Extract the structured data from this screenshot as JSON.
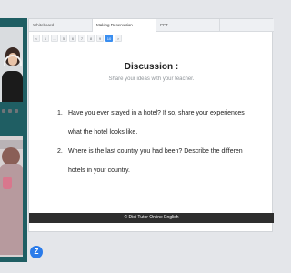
{
  "tabs": [
    {
      "label": "Whiteboard",
      "active": false
    },
    {
      "label": "Making Reservation",
      "active": true
    },
    {
      "label": "PPT",
      "active": false
    }
  ],
  "pager": {
    "buttons": [
      "<",
      "1",
      "...",
      "5",
      "6",
      "7",
      "8",
      "9",
      "10",
      ">"
    ],
    "current": "10"
  },
  "slide": {
    "title": "Discussion :",
    "subtitle": "Share your ideas with your teacher.",
    "questions": [
      {
        "num": "1.",
        "line1": "Have you ever stayed in a hotel? If so, share your experiences",
        "line2": "what the hotel looks like."
      },
      {
        "num": "2.",
        "line1": "Where is the last country you had been? Describe the differen",
        "line2": "hotels in your country."
      }
    ],
    "footer": "© Didi Tutor Online English"
  },
  "chat_button": {
    "glyph": "Z"
  },
  "colors": {
    "accent": "#3a8ef0",
    "rail": "#1f5e63",
    "footer_bg": "#2e2e2e",
    "chat": "#2a7bea"
  }
}
